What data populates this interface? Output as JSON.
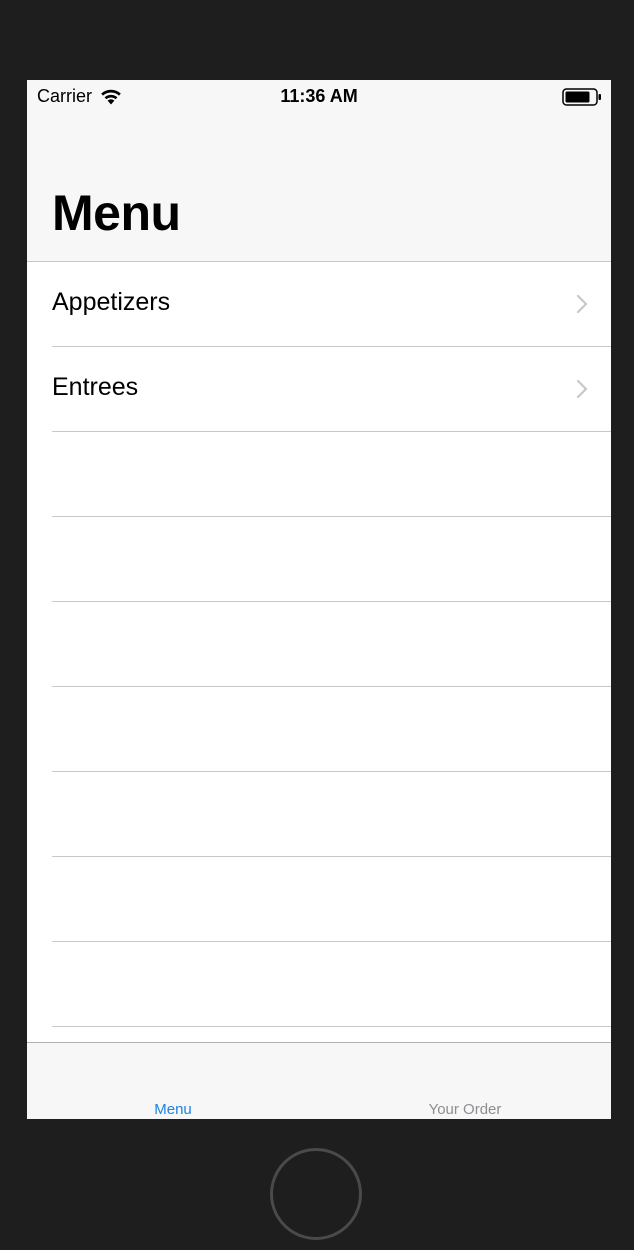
{
  "status_bar": {
    "carrier": "Carrier",
    "time": "11:36 AM",
    "wifi_icon": "wifi-icon",
    "battery_icon": "battery-icon"
  },
  "nav": {
    "title": "Menu"
  },
  "table": {
    "rows": [
      {
        "label": "Appetizers",
        "icon": "chevron-right-icon"
      },
      {
        "label": "Entrees",
        "icon": "chevron-right-icon"
      }
    ]
  },
  "tab_bar": {
    "tabs": [
      {
        "label": "Menu",
        "selected": true
      },
      {
        "label": "Your Order",
        "selected": false
      }
    ]
  },
  "colors": {
    "accent": "#1a82e8",
    "inactive_tab": "#8e8e93",
    "bezel": "#1e1e1e",
    "separator": "#c8c7cc"
  }
}
